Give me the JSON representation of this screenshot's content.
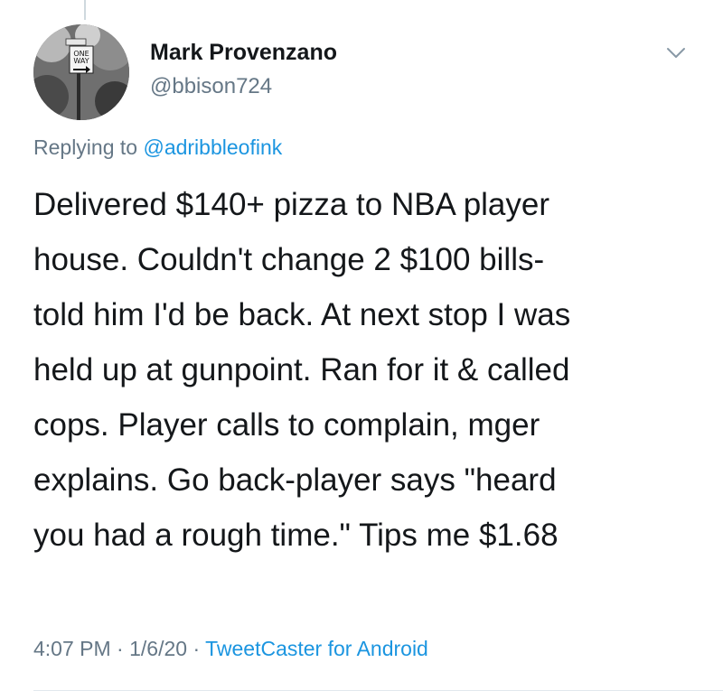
{
  "author": {
    "name": "Mark Provenzano",
    "handle": "@bbison724",
    "avatar_sign_line1": "ONE",
    "avatar_sign_line2": "WAY"
  },
  "reply": {
    "prefix": "Replying to ",
    "target": "@adribbleofink"
  },
  "tweet": {
    "lines": [
      "Delivered $140+ pizza to NBA player",
      "house. Couldn't change 2 $100 bills-",
      "told him I'd be back. At next stop I was",
      "held up at gunpoint. Ran for it & called",
      "cops. Player calls to complain, mger",
      "explains. Go back-player says \"heard",
      "you had a rough time.\" Tips me $1.68"
    ]
  },
  "meta": {
    "time": "4:07 PM",
    "separator": "·",
    "date": "1/6/20",
    "source": "TweetCaster for Android"
  },
  "icons": {
    "menu": "chevron-down-icon"
  },
  "colors": {
    "link": "#1b95e0",
    "secondary_text": "#657786",
    "primary_text": "#14171a"
  }
}
